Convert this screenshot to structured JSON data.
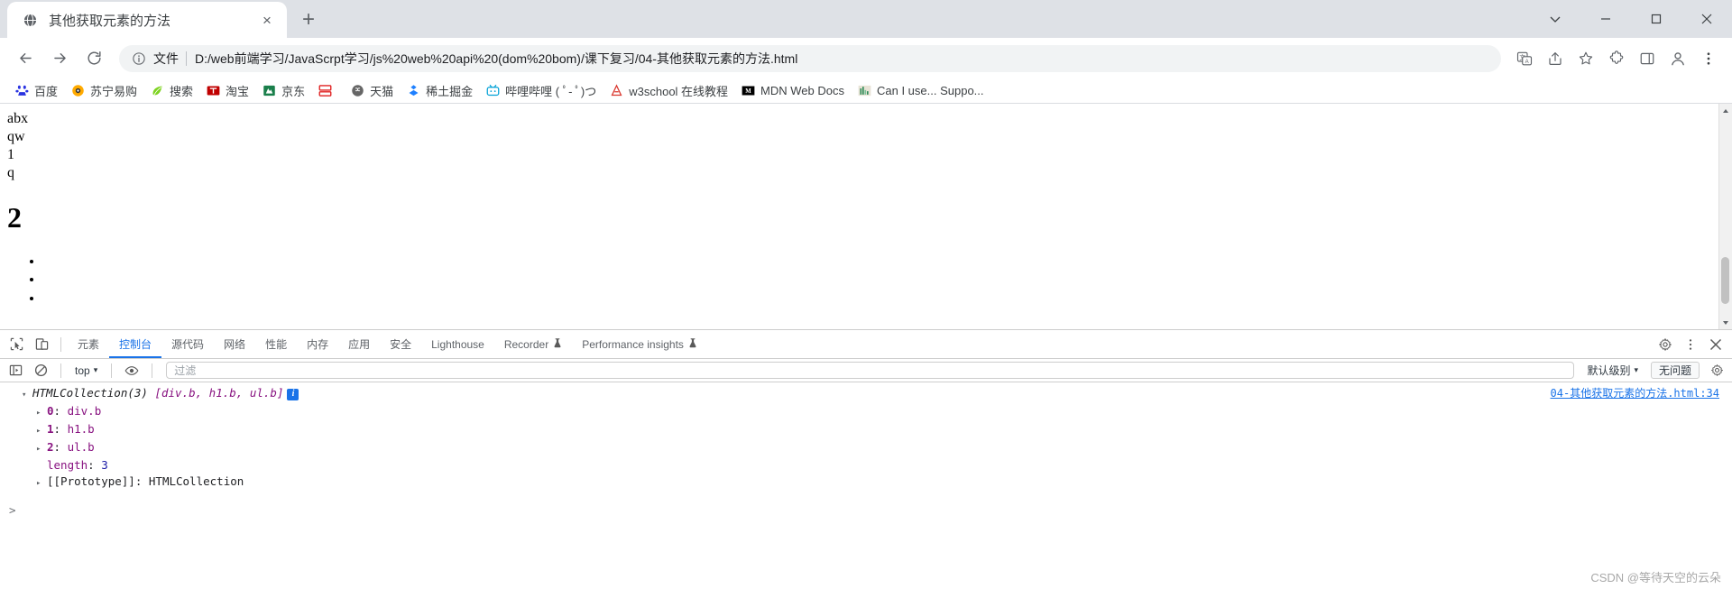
{
  "window": {
    "controls": [
      "minimize-extra",
      "minimize",
      "maximize",
      "close"
    ]
  },
  "tab": {
    "title": "其他获取元素的方法",
    "close_label": "×",
    "newtab_label": "+"
  },
  "toolbar": {
    "back_label": "←",
    "forward_label": "→",
    "reload_label": "⟳",
    "scheme_label": "文件",
    "url": "D:/web前端学习/JavaScrpt学习/js%20web%20api%20(dom%20bom)/课下复习/04-其他获取元素的方法.html"
  },
  "bookmarks": [
    {
      "label": "百度",
      "icon": "baidu-icon",
      "color": "#2932e1"
    },
    {
      "label": "苏宁易购",
      "icon": "suning-icon",
      "color": "#ffaa00"
    },
    {
      "label": "搜索",
      "icon": "search-leaf-icon",
      "color": "#7ed321"
    },
    {
      "label": "淘宝",
      "icon": "taobao-icon",
      "color": "#c00000"
    },
    {
      "label": "京东",
      "icon": "jd-icon",
      "color": "#1a7f4b"
    },
    {
      "label": "",
      "icon": "pinduoduo-icon",
      "color": "#e02020"
    },
    {
      "label": "天猫",
      "icon": "tmall-icon",
      "color": "#666666"
    },
    {
      "label": "稀土掘金",
      "icon": "juejin-icon",
      "color": "#1e80ff"
    },
    {
      "label": "哔哩哔哩 ( ﾟ- ﾟ)つ",
      "icon": "bilibili-icon",
      "color": "#00a1d6"
    },
    {
      "label": "w3school 在线教程",
      "icon": "w3school-icon",
      "color": "#d9352c"
    },
    {
      "label": "MDN Web Docs",
      "icon": "mdn-icon",
      "color": "#000000"
    },
    {
      "label": "Can I use... Suppo...",
      "icon": "caniuse-icon",
      "color": "#2e8b57"
    }
  ],
  "page": {
    "lines": [
      "abx",
      "qw",
      "1",
      "q"
    ],
    "heading": "2",
    "list_items": [
      "",
      "",
      ""
    ]
  },
  "devtools": {
    "inspect_icon": "inspect-element-icon",
    "device_icon": "device-toolbar-icon",
    "tabs": [
      {
        "label": "元素",
        "active": false,
        "experimental": false
      },
      {
        "label": "控制台",
        "active": true,
        "experimental": false
      },
      {
        "label": "源代码",
        "active": false,
        "experimental": false
      },
      {
        "label": "网络",
        "active": false,
        "experimental": false
      },
      {
        "label": "性能",
        "active": false,
        "experimental": false
      },
      {
        "label": "内存",
        "active": false,
        "experimental": false
      },
      {
        "label": "应用",
        "active": false,
        "experimental": false
      },
      {
        "label": "安全",
        "active": false,
        "experimental": false
      },
      {
        "label": "Lighthouse",
        "active": false,
        "experimental": false
      },
      {
        "label": "Recorder",
        "active": false,
        "experimental": true
      },
      {
        "label": "Performance insights",
        "active": false,
        "experimental": true
      }
    ],
    "settings_icon": "gear-icon",
    "more_icon": "more-vertical-icon",
    "close_icon": "close-icon",
    "filterbar": {
      "sidebar_icon": "console-sidebar-icon",
      "clear_icon": "clear-console-icon",
      "context": "top",
      "context_caret": "▾",
      "eye_icon": "live-expression-eye-icon",
      "filter_placeholder": "过滤",
      "level": "默认级别",
      "level_caret": "▾",
      "issues": "无问题",
      "settings_icon": "console-settings-gear-icon"
    },
    "console": {
      "source_link": "04-其他获取元素的方法.html:34",
      "entry": {
        "collapse_caret": "▾",
        "type": "HTMLCollection(3)",
        "preview_open": "[",
        "preview_items": "div.b, h1.b, ul.b",
        "preview_close": "]",
        "info_badge": "i",
        "children": [
          {
            "caret": "▸",
            "key": "0",
            "sep": ": ",
            "value": "div.b"
          },
          {
            "caret": "▸",
            "key": "1",
            "sep": ": ",
            "value": "h1.b"
          },
          {
            "caret": "▸",
            "key": "2",
            "sep": ": ",
            "value": "ul.b"
          }
        ],
        "length_key": "length",
        "length_sep": ": ",
        "length_value": "3",
        "proto_caret": "▸",
        "proto_key": "[[Prototype]]",
        "proto_sep": ": ",
        "proto_value": "HTMLCollection"
      },
      "prompt": ">"
    }
  },
  "watermark": "CSDN @等待天空的云朵"
}
